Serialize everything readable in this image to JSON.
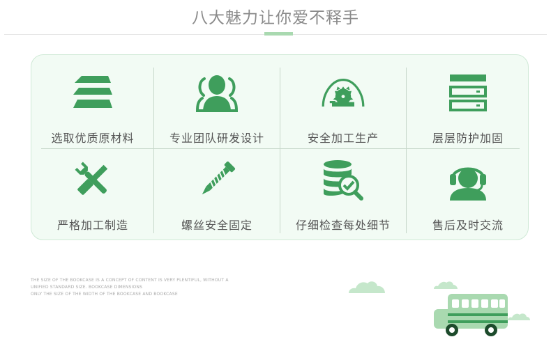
{
  "header": {
    "title": "八大魅力让你爱不释手"
  },
  "features": [
    {
      "icon": "layered-material-icon",
      "label": "选取优质原材料"
    },
    {
      "icon": "team-icon",
      "label": "专业团队研发设计"
    },
    {
      "icon": "saw-blade-icon",
      "label": "安全加工生产"
    },
    {
      "icon": "stacked-drawers-icon",
      "label": "层层防护加固"
    },
    {
      "icon": "tools-icon",
      "label": "严格加工制造"
    },
    {
      "icon": "screw-icon",
      "label": "螺丝安全固定"
    },
    {
      "icon": "database-check-icon",
      "label": "仔细检查每处细节"
    },
    {
      "icon": "customer-service-icon",
      "label": "售后及时交流"
    }
  ],
  "footer_note": {
    "lines": [
      "THE SIZE OF THE BOOKCASE IS A CONCEPT OF CONTENT IS VERY PLENTIFUL, WITHOUT A",
      "UNIFIED STANDARD SIZE. BOOKCASE DIMENSIONS",
      "ONLY THE SIZE OF THE WIDTH OF THE BOOKCASE AND BOOKCASE"
    ]
  },
  "colors": {
    "icon_green": "#3f9e5c",
    "light_green": "#a9d9b0",
    "panel_bg": "#f2fbf4",
    "text_gray": "#555555",
    "title_gray": "#8a8a8a"
  }
}
